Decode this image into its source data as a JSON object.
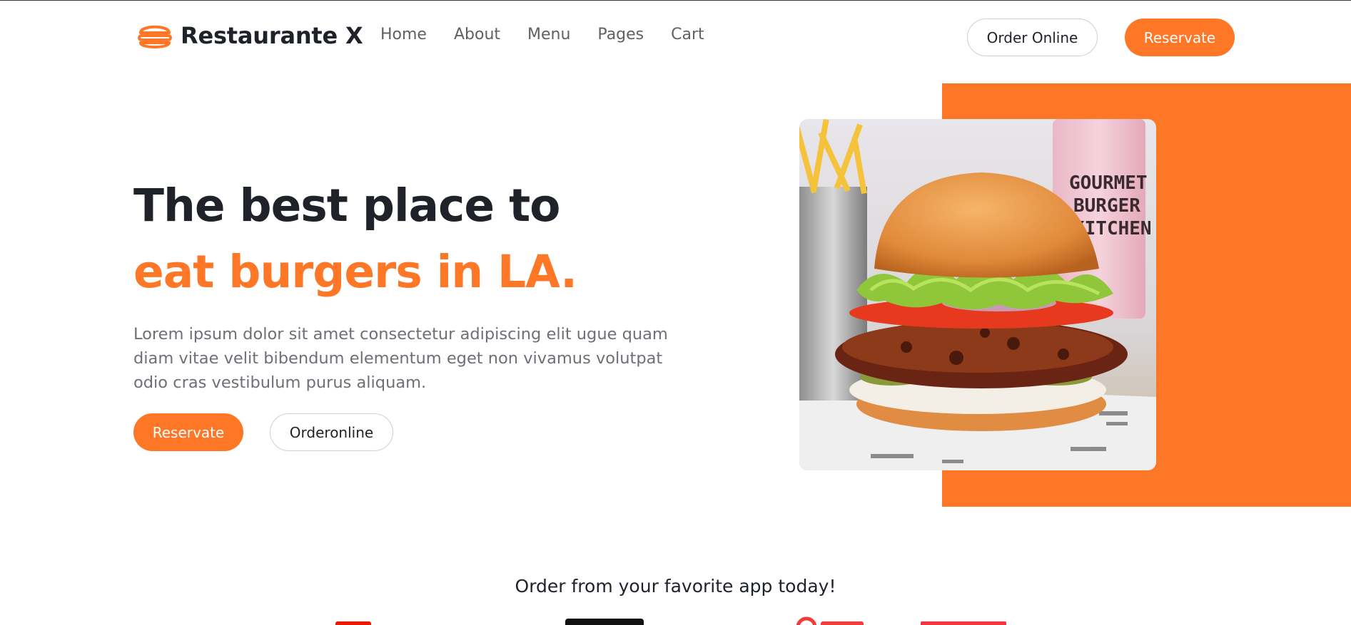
{
  "brand": {
    "name": "Restaurante X",
    "accent": "#fd7726",
    "icon": "burger-icon"
  },
  "nav": {
    "items": [
      "Home",
      "About",
      "Menu",
      "Pages",
      "Cart"
    ]
  },
  "header": {
    "order_label": "Order Online",
    "reserve_label": "Reservate"
  },
  "hero": {
    "title_line1": "The best place to",
    "title_line2": "eat burgers in LA.",
    "description": "Lorem ipsum dolor sit amet consectetur adipiscing elit ugue quam diam vitae velit bibendum elementum eget non vivamus volutpat odio cras vestibulum purus aliquam.",
    "reserve_label": "Reservate",
    "order_label": "Orderonline",
    "image_cup_text": [
      "GOURMET",
      "BURGER",
      "KITCHEN"
    ]
  },
  "order_section": {
    "title": "Order from your favorite app today!"
  }
}
